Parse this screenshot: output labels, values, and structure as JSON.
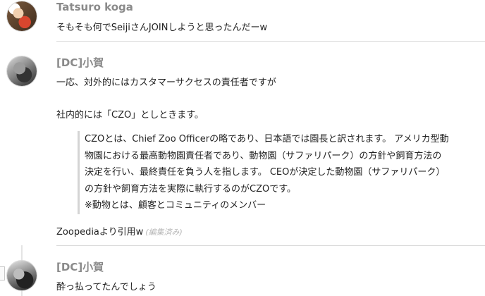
{
  "messages": [
    {
      "author": "Tatsuro koga",
      "text": "そもそも何でSeijiさんJOINしようと思ったんだーw"
    },
    {
      "author": "[DC]小賀",
      "text_1": "一応、対外的にはカスタマーサクセスの責任者ですが",
      "text_2": "社内的には「CZO」としときます。",
      "quote_lines": [
        "CZOとは、Chief Zoo Officerの略であり、日本語では園長と訳されます。 アメリカ型動",
        "物園における最高動物園責任者であり、動物園（サファリパーク）の方針や飼育方法の",
        "決定を行い、最終責任を負う人を指します。 CEOが決定した動物園（サファリパーク）",
        "の方針や飼育方法を実際に執行するのがCZOです。",
        "※動物とは、顧客とコミュニティのメンバー"
      ],
      "text_3": "Zoopediaより引用w",
      "edited_label": "(編集済み)"
    },
    {
      "author": "[DC]小賀",
      "text": "酔っ払ってたんでしょう"
    }
  ]
}
